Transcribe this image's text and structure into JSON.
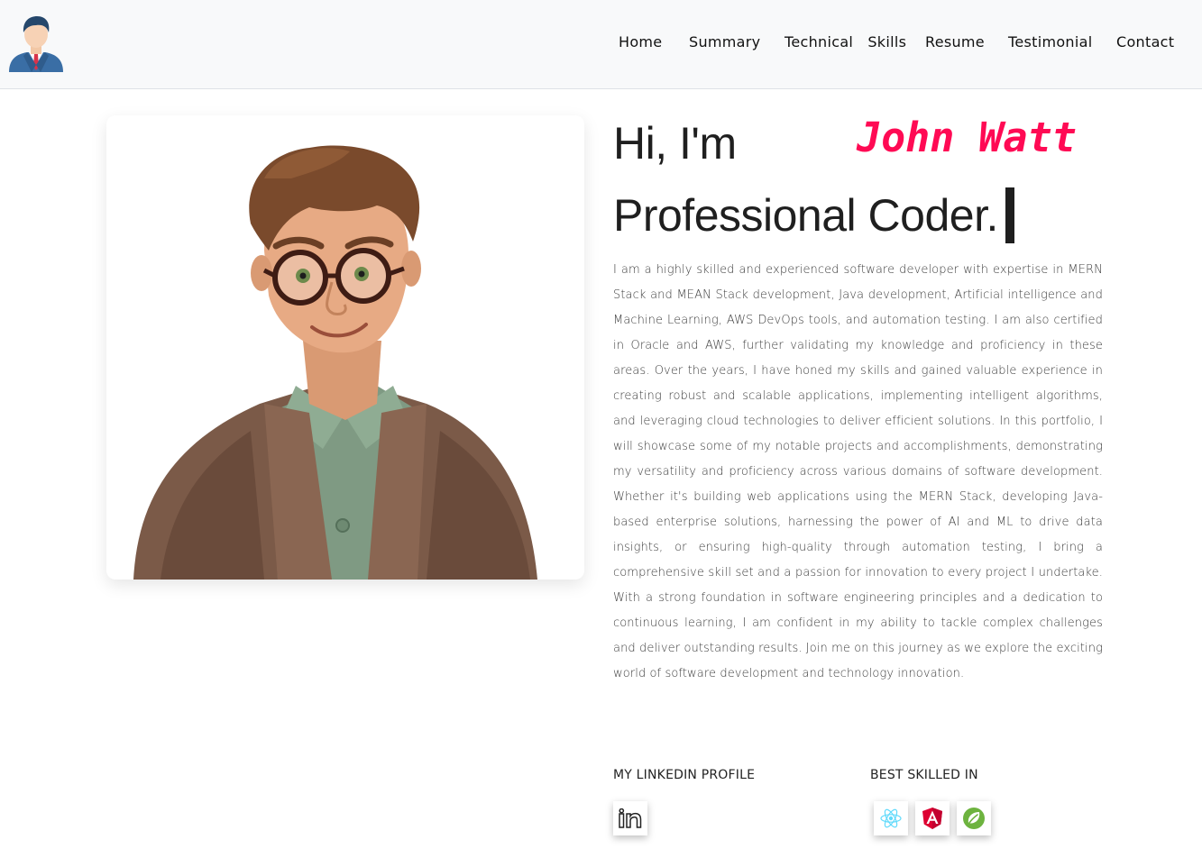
{
  "nav": {
    "logo_icon": "businessman-avatar-icon",
    "items": [
      "Home",
      "Summary",
      "Technical   Skills",
      "Resume",
      "Testimonial",
      "Contact"
    ]
  },
  "hero": {
    "greeting": "Hi, I'm",
    "name": "John Watt",
    "role": "Professional Coder.",
    "name_color": "#ff0a54",
    "portrait_icon": "cartoon-developer-portrait",
    "bio": "I am a highly skilled and experienced software developer with expertise in MERN Stack and MEAN Stack development, Java development, Artificial intelligence and Machine Learning, AWS DevOps tools, and automation testing. I am also certified in Oracle and AWS, further validating my knowledge and proficiency in these areas. Over the years, I have honed my skills and gained valuable experience in creating robust and scalable applications, implementing intelligent algorithms, and leveraging cloud technologies to deliver efficient solutions. In this portfolio, I will showcase some of my notable projects and accomplishments, demonstrating my versatility and proficiency across various domains of software development. Whether it's building web applications using the MERN Stack, developing Java-based enterprise solutions, harnessing the power of AI and ML to drive data insights, or ensuring high-quality through automation testing, I bring a comprehensive skill set and a passion for innovation to every project I undertake. With a strong foundation in software engineering principles and a dedication to continuous learning, I am confident in my ability to tackle complex challenges and deliver outstanding results. Join me on this journey as we explore the exciting world of software development and technology innovation."
  },
  "linkedin": {
    "title": "MY LINKEDIN PROFILE",
    "icon": "linkedin-icon"
  },
  "skills": {
    "title": "BEST SKILLED IN",
    "icons": [
      "react-icon",
      "angular-icon",
      "spring-icon"
    ]
  }
}
